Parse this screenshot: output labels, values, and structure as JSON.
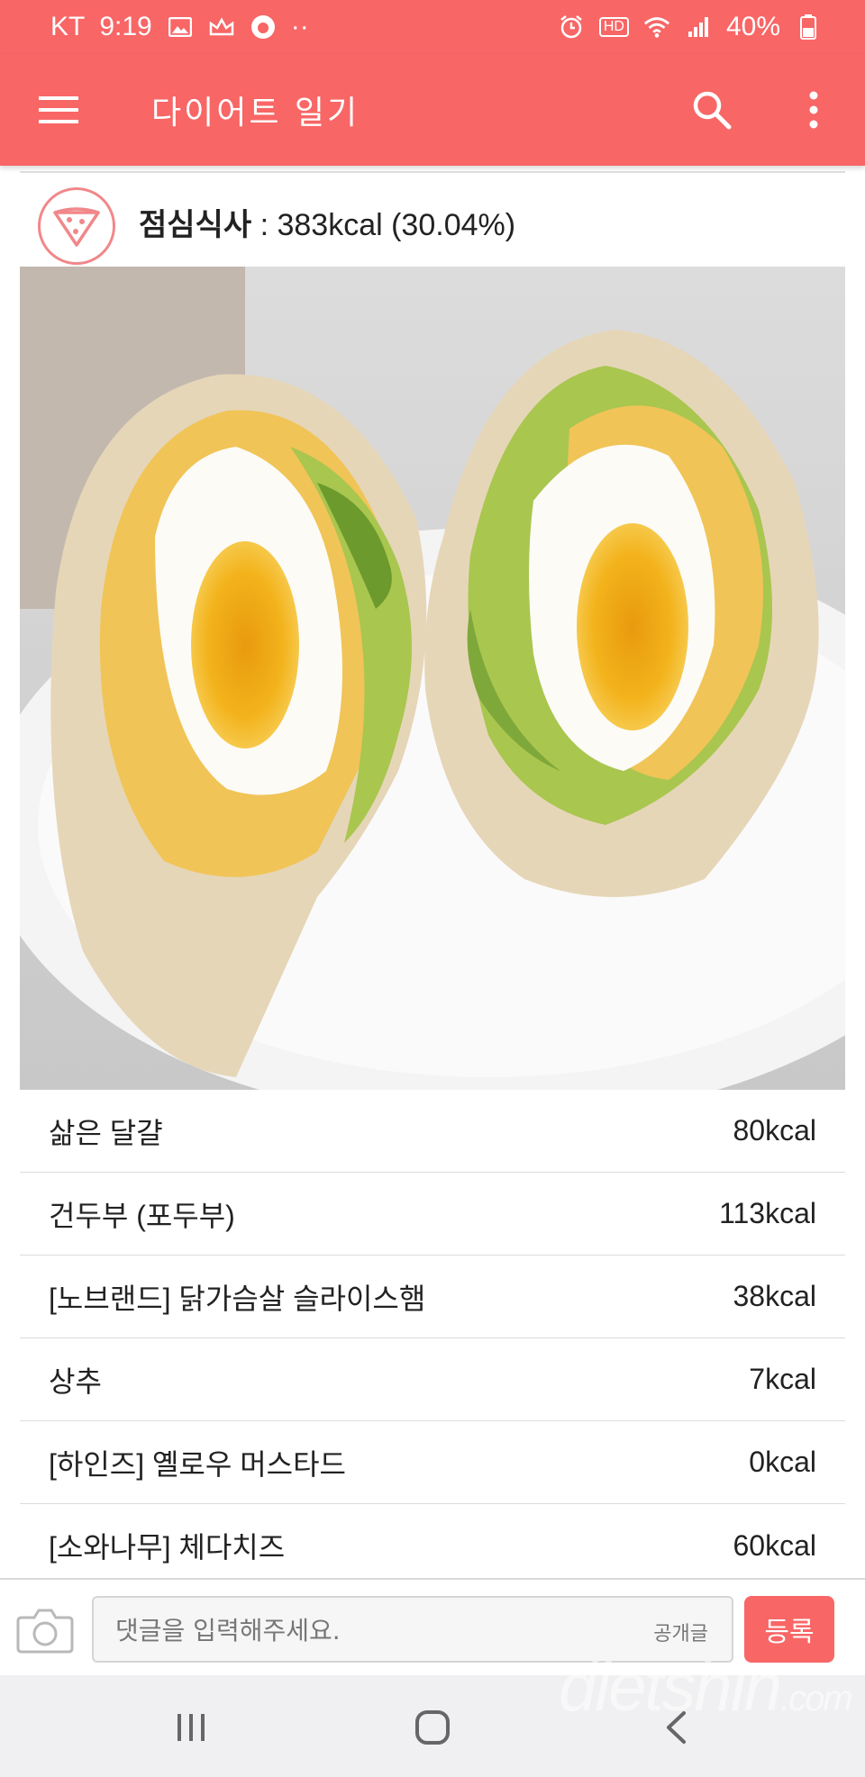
{
  "status_bar": {
    "carrier": "KT",
    "time": "9:19",
    "dots": "··",
    "hd": "HD",
    "battery": "40%",
    "left_icons": [
      "image-icon",
      "crown-icon",
      "app-icon"
    ],
    "right_icons": [
      "alarm-icon",
      "hd-icon",
      "wifi-icon",
      "signal-icon",
      "battery-icon"
    ]
  },
  "app_bar": {
    "title": "다이어트 일기",
    "icons": [
      "menu-icon",
      "search-icon",
      "more-icon"
    ]
  },
  "meal": {
    "icon": "pizza-icon",
    "name": "점심식사",
    "summary": " : 383kcal (30.04%)"
  },
  "photo": {
    "description_icon": "meal-photo"
  },
  "foods": [
    {
      "name": "삶은 달걀",
      "kcal": "80kcal"
    },
    {
      "name": "건두부 (포두부)",
      "kcal": "113kcal"
    },
    {
      "name": "[노브랜드] 닭가슴살 슬라이스햄",
      "kcal": "38kcal"
    },
    {
      "name": "상추",
      "kcal": "7kcal"
    },
    {
      "name": "[하인즈] 옐로우 머스타드",
      "kcal": "0kcal"
    },
    {
      "name": "[소와나무] 체다치즈",
      "kcal": "60kcal"
    }
  ],
  "comment": {
    "placeholder": "댓글을 입력해주세요.",
    "visibility": "공개글",
    "submit": "등록",
    "camera_icon": "camera-icon"
  },
  "nav": {
    "icons": [
      "recents-icon",
      "home-icon",
      "back-icon"
    ]
  },
  "watermark": {
    "brand": "dietshin",
    "suffix": ".com"
  },
  "colors": {
    "accent": "#f86666",
    "divider": "#dcdcdc"
  }
}
